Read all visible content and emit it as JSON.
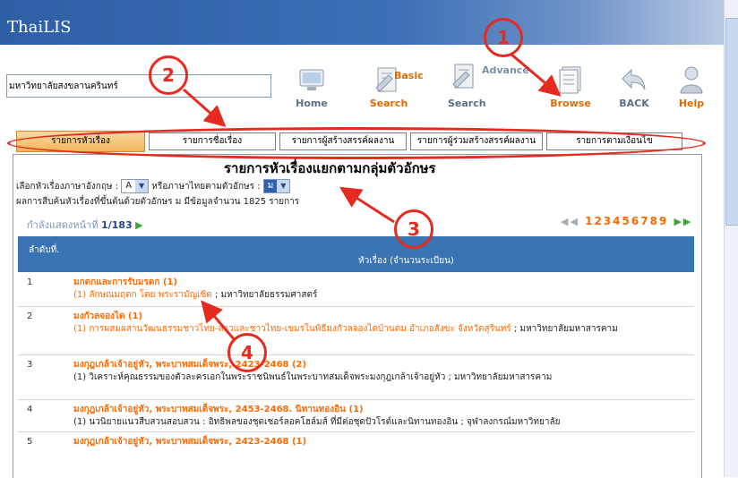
{
  "brand": "ThaiLIS",
  "institution_field": {
    "value": "มหาวิทยาลัยสงขลานครินทร์"
  },
  "toolbar": {
    "home": "Home",
    "basic_search_top": "Basic",
    "basic_search": "Search",
    "advance_search_top": "Advance",
    "advance_search": "Search",
    "browse": "Browse",
    "back": "BACK",
    "help": "Help"
  },
  "tabs": [
    "รายการหัวเรื่อง",
    "รายการชื่อเรื่อง",
    "รายการผู้สร้างสรรค์ผลงาน",
    "รายการผู้ร่วมสร้างสรรค์ผลงาน",
    "รายการตามเงื่อนไข"
  ],
  "page_title": "รายการหัวเรื่องแยกตามกลุ่มตัวอักษร",
  "filter": {
    "label_en": "เลือกหัวเรื่องภาษาอังกฤษ :",
    "value_en": "A",
    "label_th": "หรือภาษาไทยตามตัวอักษร :",
    "value_th": "ม"
  },
  "summary": "ผลการสืบค้นหัวเรื่องที่ขึ้นต้นด้วยตัวอักษร ม มีข้อมูลจำนวน 1825 รายการ",
  "page_info": {
    "label": "กำลังแสดงหน้าที่",
    "value": "1/183"
  },
  "pager": {
    "pages": "123456789"
  },
  "table": {
    "col_no": "ลำดับที่.",
    "col_subject": "หัวเรื่อง (จำนวนระเบียน)",
    "rows": [
      {
        "no": "1",
        "heading": "มกดกและการรับมรดก (1)",
        "item": "(1) ลักษณมฤดก โดย พระรามัญเซิด",
        "source": " ; มหาวิทยาลัยธรรมศาสตร์"
      },
      {
        "no": "2",
        "heading": "มงกัวลจองได (1)",
        "item": "(1) การผสมผสานวัฒนธรรมชาวไทย-ลาวและชาวไทย-เขมรในพิธีมงกัวลจองไดบ้านตม อำเภอสังขะ จังหวัดสุรินทร์",
        "source": " ; มหาวิทยาลัยมหาสารคาม"
      },
      {
        "no": "3",
        "heading": "มงกุฎเกล้าเจ้าอยู่หัว, พระบาทสมเด็จพระ, 2423-2468 (2)",
        "item": "(1) วิเคราะห์คุณธรรมของตัวละครเอกในพระราชนิพนธ์ในพระบาทสมเด็จพระมงกุฎเกล้าเจ้าอยู่หัว",
        "source": " ; มหาวิทยาลัยมหาสารคาม"
      },
      {
        "no": "4",
        "heading": "มงกุฎเกล้าเจ้าอยู่หัว, พระบาทสมเด็จพระ, 2453-2468. นิทานทองอิน (1)",
        "item": "(1) นวนิยายแนวสืบสวนสอบสวน : อิทธิพลของชุดเชอร์ลอคโฮล์มส์ ที่มีต่อชุดปัวโรต์และนิทานทองอิน",
        "source": " ; จุฬาลงกรณ์มหาวิทยาลัย"
      },
      {
        "no": "5",
        "heading": "มงกุฎเกล้าเจ้าอยู่หัว, พระบาทสมเด็จพระ, 2423-2468 (1)",
        "item": "",
        "source": ""
      }
    ]
  },
  "annotations": [
    "1",
    "2",
    "3",
    "4"
  ]
}
